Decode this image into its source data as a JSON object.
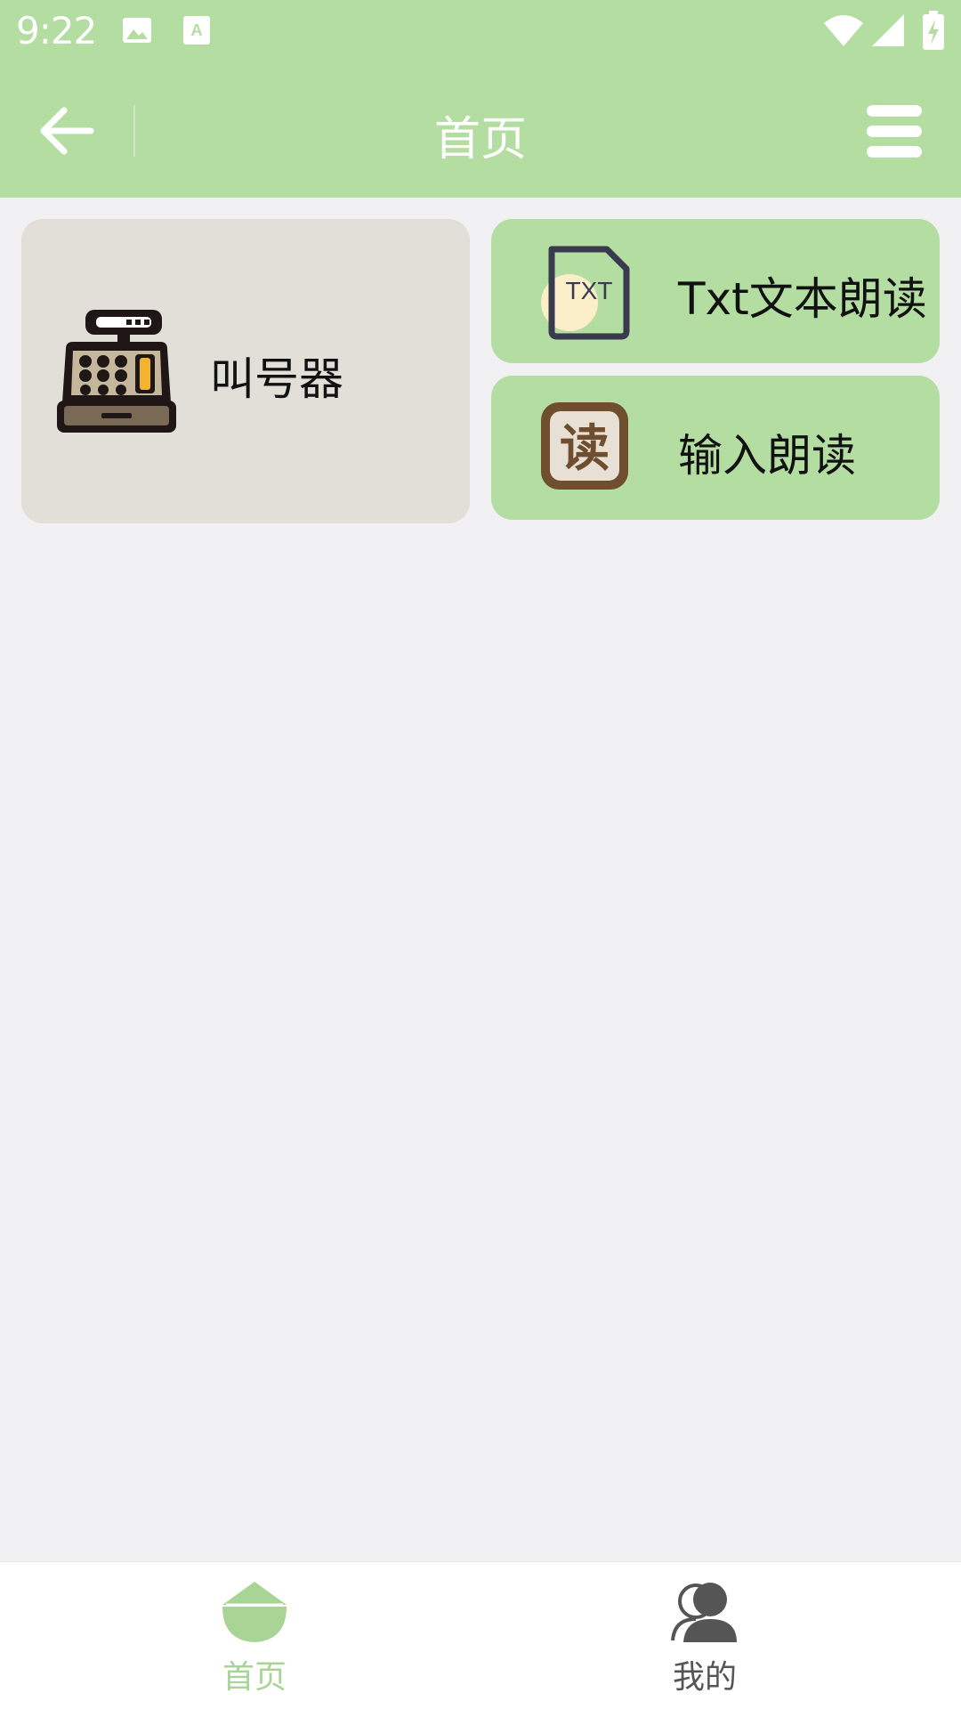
{
  "status_bar": {
    "time": "9:22",
    "icons": [
      "image-icon",
      "text-a-icon",
      "wifi-icon",
      "signal-icon",
      "battery-charging-icon"
    ]
  },
  "nav": {
    "title": "首页",
    "back_icon": "arrow-left-icon",
    "menu_icon": "hamburger-menu-icon"
  },
  "cards": {
    "caller": {
      "label": "叫号器",
      "icon": "cash-register-icon"
    },
    "txt_read": {
      "label": "Txt文本朗读",
      "icon": "txt-file-icon",
      "icon_text": "TXT"
    },
    "input_read": {
      "label": "输入朗读",
      "icon": "read-char-icon",
      "icon_text": "读"
    }
  },
  "tabs": [
    {
      "label": "首页",
      "icon": "home-icon",
      "active": true
    },
    {
      "label": "我的",
      "icon": "user-icon",
      "active": false
    }
  ],
  "colors": {
    "primary": "#b3dda1",
    "background": "#f1f1f3",
    "caller_card": "#e2dfd8",
    "tab_active": "#a8d596",
    "tab_inactive": "#555555"
  }
}
